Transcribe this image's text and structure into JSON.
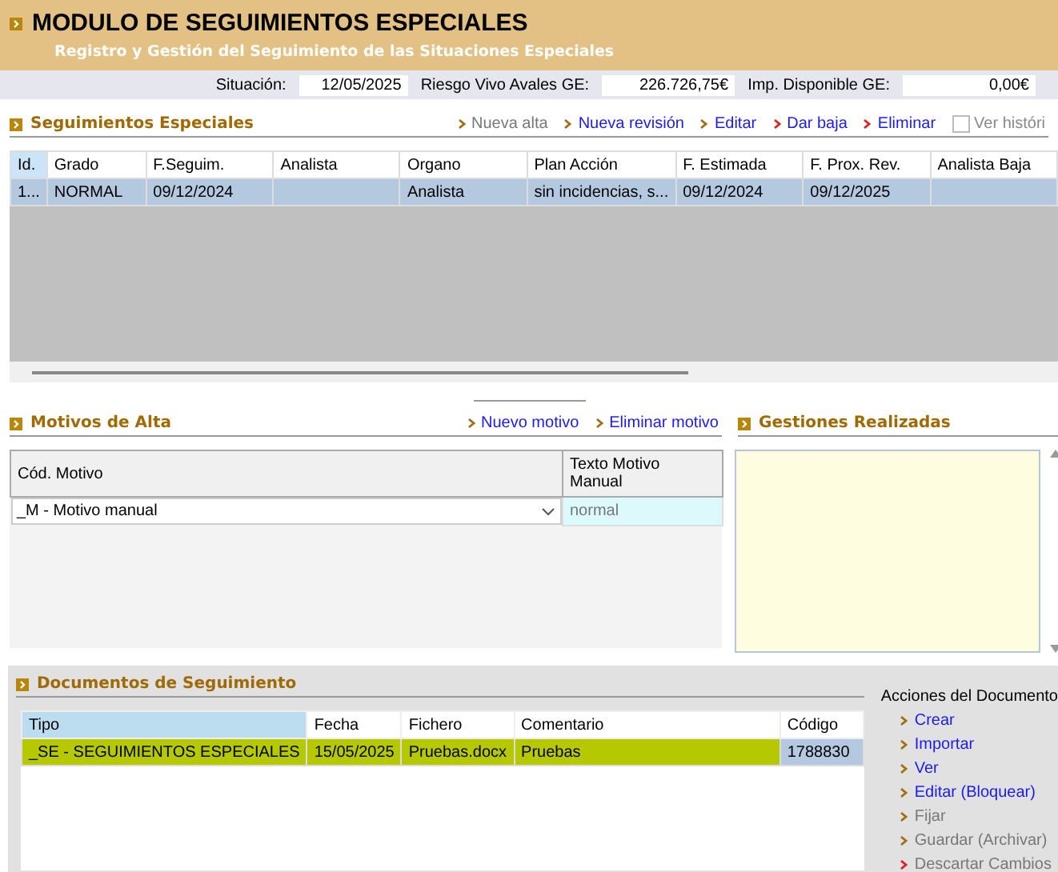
{
  "header": {
    "title": "MODULO DE SEGUIMIENTOS ESPECIALES",
    "subtitle": "Registro y Gestión del Seguimiento de las Situaciones Especiales"
  },
  "info_bar": [
    {
      "label": "Situación:",
      "value": "12/05/2025"
    },
    {
      "label": "Riesgo Vivo Avales GE:",
      "value": "226.726,75€"
    },
    {
      "label": "Imp. Disponible GE:",
      "value": "0,00€"
    }
  ],
  "seguimientos": {
    "title": "Seguimientos Especiales",
    "actions": [
      {
        "label": "Nueva alta",
        "disabled": true,
        "kind": "normal"
      },
      {
        "label": "Nueva revisión",
        "disabled": false,
        "kind": "normal"
      },
      {
        "label": "Editar",
        "disabled": false,
        "kind": "normal"
      },
      {
        "label": "Dar baja",
        "disabled": false,
        "kind": "danger"
      },
      {
        "label": "Eliminar",
        "disabled": false,
        "kind": "danger"
      }
    ],
    "ver_historico": {
      "label": "Ver históri",
      "checked": false
    },
    "table": {
      "columns": [
        "Id.",
        "Grado",
        "F.Seguim.",
        "Analista",
        "Organo",
        "Plan Acción",
        "F. Estimada",
        "F. Prox. Rev.",
        "Analista Baja"
      ],
      "rows": [
        {
          "selected": true,
          "cells": [
            "1...",
            "NORMAL",
            "09/12/2024",
            "",
            "Analista",
            "sin incidencias, s...",
            "09/12/2024",
            "09/12/2025",
            ""
          ]
        }
      ]
    }
  },
  "motivos": {
    "title": "Motivos de Alta",
    "actions": [
      {
        "label": "Nuevo motivo"
      },
      {
        "label": "Eliminar motivo"
      }
    ],
    "columns": [
      "Cód. Motivo",
      "Texto Motivo Manual"
    ],
    "rows": [
      {
        "motivo": "_M - Motivo manual",
        "texto": "normal"
      }
    ]
  },
  "gestiones": {
    "title": "Gestiones Realizadas"
  },
  "documentos": {
    "title": "Documentos de Seguimiento",
    "columns": [
      "Tipo",
      "Fecha",
      "Fichero",
      "Comentario",
      "Código"
    ],
    "rows": [
      {
        "selected": true,
        "highlighted": true,
        "cells": [
          "_SE - SEGUIMIENTOS ESPECIALES",
          "15/05/2025",
          "Pruebas.docx",
          "Pruebas",
          "1788830"
        ]
      }
    ],
    "actions_title": "Acciones del Documento",
    "actions": [
      {
        "label": "Crear",
        "disabled": false,
        "kind": "normal"
      },
      {
        "label": "Importar",
        "disabled": false,
        "kind": "normal"
      },
      {
        "label": "Ver",
        "disabled": false,
        "kind": "normal"
      },
      {
        "label": "Editar (Bloquear)",
        "disabled": false,
        "kind": "normal"
      },
      {
        "label": "Fijar",
        "disabled": true,
        "kind": "normal"
      },
      {
        "label": "Guardar (Archivar)",
        "disabled": true,
        "kind": "normal"
      },
      {
        "label": "Descartar Cambios",
        "disabled": true,
        "kind": "danger"
      }
    ]
  }
}
